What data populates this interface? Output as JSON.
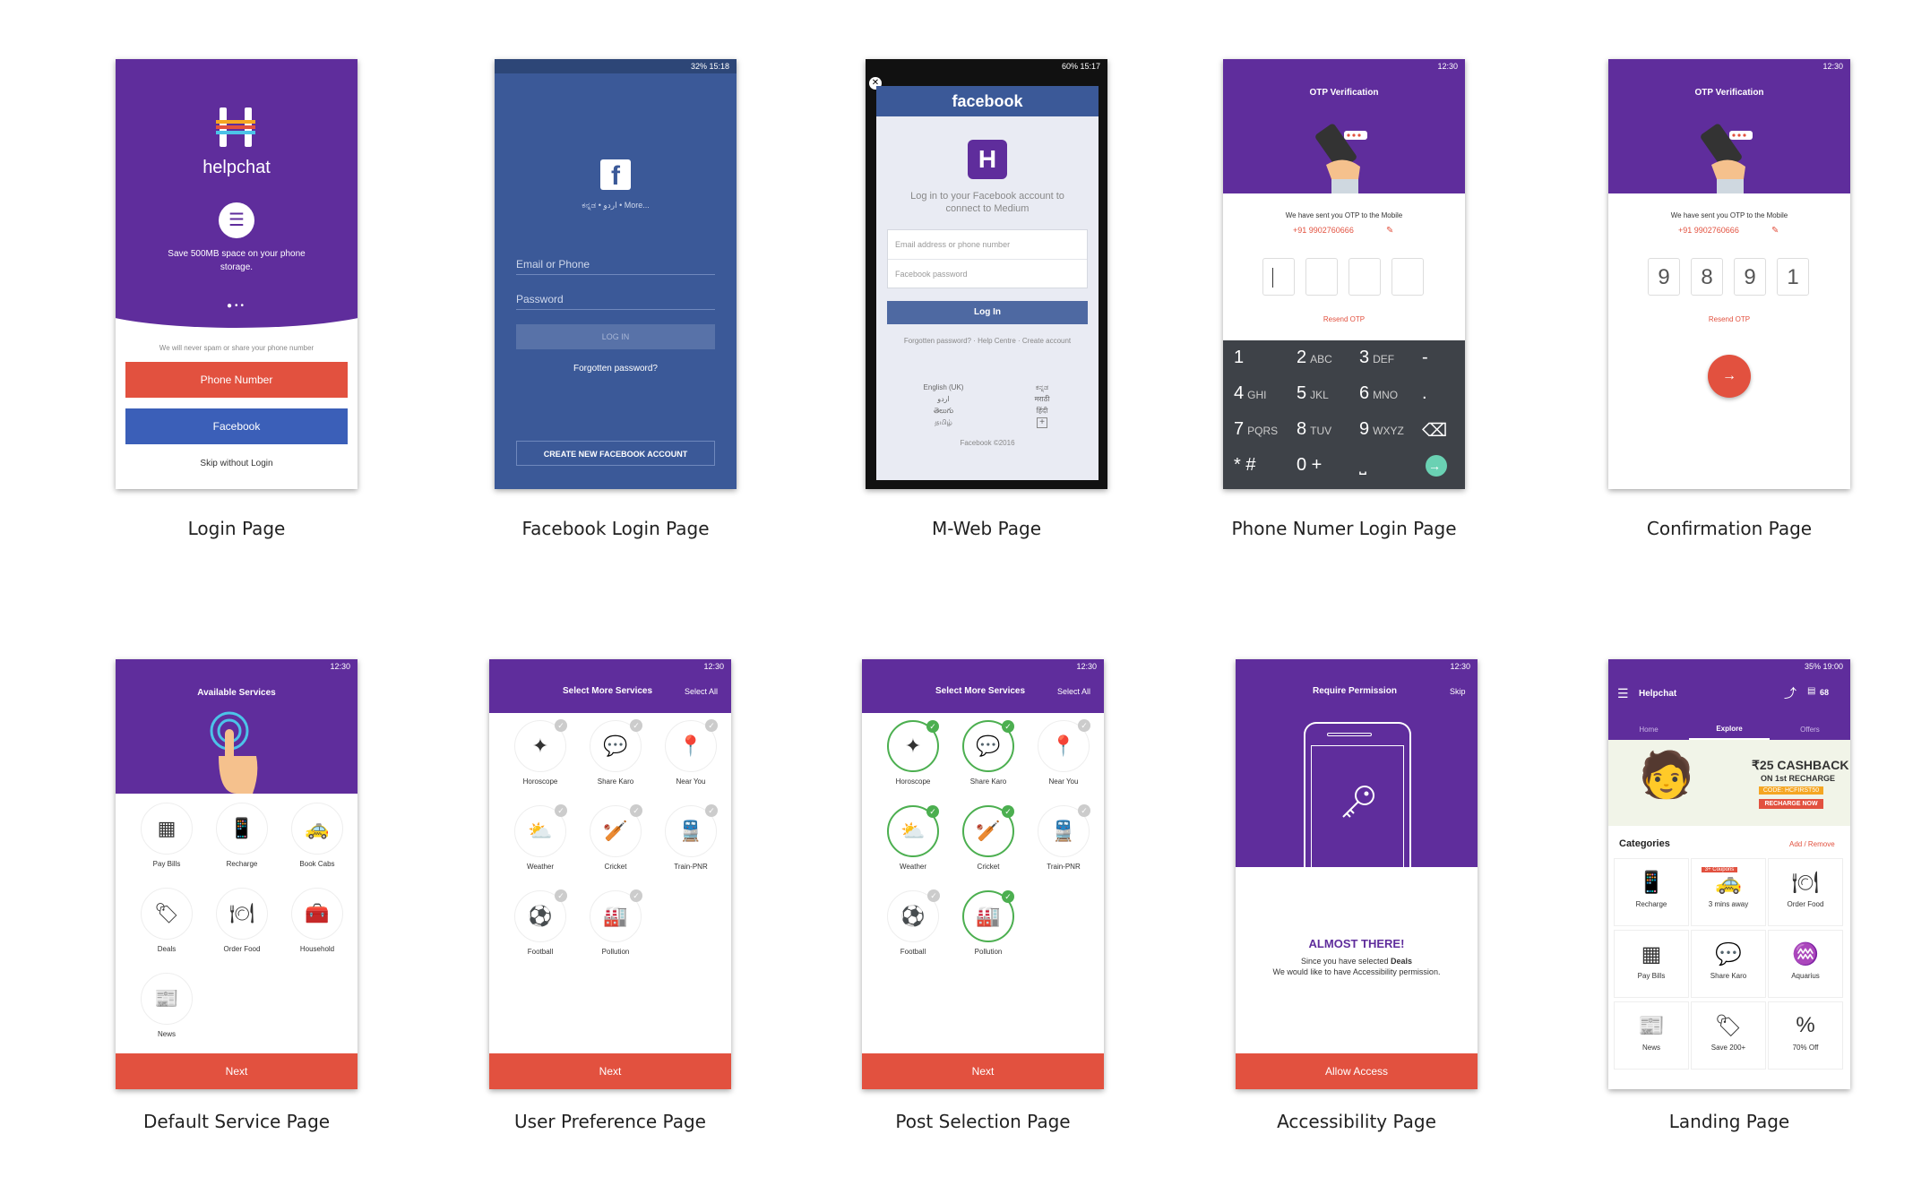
{
  "captions": [
    "Login Page",
    "Facebook Login Page",
    "M-Web Page",
    "Phone Numer Login Page",
    "Confirmation Page",
    "Default Service Page",
    "User Preference Page",
    "Post Selection Page",
    "Accessibility Page",
    "Landing Page"
  ],
  "login": {
    "brand": "helpchat",
    "promo": "Save 500MB space on your phone storage.",
    "note": "We will never spam or share your phone number",
    "phone_btn": "Phone Number",
    "fb_btn": "Facebook",
    "skip": "Skip without Login"
  },
  "fb_login": {
    "status": "32% 15:18",
    "langs": "ಕನ್ನಡ • اردو • More...",
    "email_ph": "Email or Phone",
    "pass_ph": "Password",
    "login_btn": "LOG IN",
    "forgot": "Forgotten password?",
    "create": "CREATE NEW FACEBOOK ACCOUNT"
  },
  "mweb": {
    "status": "60% 15:17",
    "fb_title": "facebook",
    "prompt": "Log in to your Facebook account to connect to Medium",
    "email_ph": "Email address or phone number",
    "pass_ph": "Facebook password",
    "login_btn": "Log In",
    "links": "Forgotten password? · Help Centre · Create account",
    "lang_left": [
      "English (UK)",
      "اردو",
      "తెలుగు",
      "தமிழ்"
    ],
    "lang_right": [
      "ಕನ್ನಡ",
      "मराठी",
      "हिंदी"
    ],
    "footer": "Facebook ©2016"
  },
  "otp": {
    "status": "12:30",
    "title": "OTP Verification",
    "sent": "We have sent you OTP to the Mobile",
    "phone": "+91 9902760666",
    "resend": "Resend OTP",
    "keys": [
      {
        "n": "1",
        "l": ""
      },
      {
        "n": "2",
        "l": "ABC"
      },
      {
        "n": "3",
        "l": "DEF"
      },
      {
        "n": "-",
        "l": ""
      },
      {
        "n": "4",
        "l": "GHI"
      },
      {
        "n": "5",
        "l": "JKL"
      },
      {
        "n": "6",
        "l": "MNO"
      },
      {
        "n": ".",
        "l": ""
      },
      {
        "n": "7",
        "l": "PQRS"
      },
      {
        "n": "8",
        "l": "TUV"
      },
      {
        "n": "9",
        "l": "WXYZ"
      },
      {
        "n": "⌫",
        "l": ""
      },
      {
        "n": "* #",
        "l": ""
      },
      {
        "n": "0 +",
        "l": ""
      },
      {
        "n": "⎵",
        "l": ""
      },
      {
        "n": "→",
        "l": ""
      }
    ]
  },
  "confirm": {
    "status": "12:30",
    "title": "OTP Verification",
    "sent": "We have sent you OTP to the Mobile",
    "phone": "+91 9902760666",
    "digits": [
      "9",
      "8",
      "9",
      "1"
    ],
    "resend": "Resend OTP"
  },
  "default_svc": {
    "status": "12:30",
    "title": "Available Services",
    "items": [
      "Pay Bills",
      "Recharge",
      "Book Cabs",
      "Deals",
      "Order Food",
      "Household",
      "News"
    ],
    "next": "Next"
  },
  "pref": {
    "status": "12:30",
    "title": "Select More Services",
    "select_all": "Select All",
    "items": [
      "Horoscope",
      "Share Karo",
      "Near You",
      "Weather",
      "Cricket",
      "Train-PNR",
      "Football",
      "Pollution"
    ],
    "next": "Next"
  },
  "post": {
    "status": "12:30",
    "title": "Select More Services",
    "select_all": "Select All",
    "items": [
      "Horoscope",
      "Share Karo",
      "Near You",
      "Weather",
      "Cricket",
      "Train-PNR",
      "Football",
      "Pollution"
    ],
    "selected": [
      true,
      true,
      false,
      true,
      true,
      false,
      false,
      true
    ],
    "next": "Next"
  },
  "access": {
    "status": "12:30",
    "title": "Require Permission",
    "skip": "Skip",
    "headline": "ALMOST THERE!",
    "line1_pre": "Since you have selected ",
    "line1_bold": "Deals",
    "line2": "We would like to have Accessibility permission.",
    "btn": "Allow Access"
  },
  "landing": {
    "status": "35% 19:00",
    "title": "Helpchat",
    "badge": "68",
    "tabs": [
      "Home",
      "Explore",
      "Offers"
    ],
    "banner_1": "₹25 CASHBACK",
    "banner_2": "ON 1st RECHARGE",
    "banner_code": "CODE: HCFIRST50",
    "banner_cta": "RECHARGE NOW",
    "categories": "Categories",
    "add_remove": "Add / Remove",
    "tag": "3+ Coupons",
    "cells": [
      "Recharge",
      "3 mins away",
      "Order Food",
      "Pay Bills",
      "Share Karo",
      "Aquarius",
      "News",
      "Save 200+",
      "70% Off"
    ]
  },
  "colors": {
    "purple": "#5f2d9c",
    "fb_blue": "#3b5998",
    "red": "#e2513f",
    "green": "#4caf50"
  }
}
